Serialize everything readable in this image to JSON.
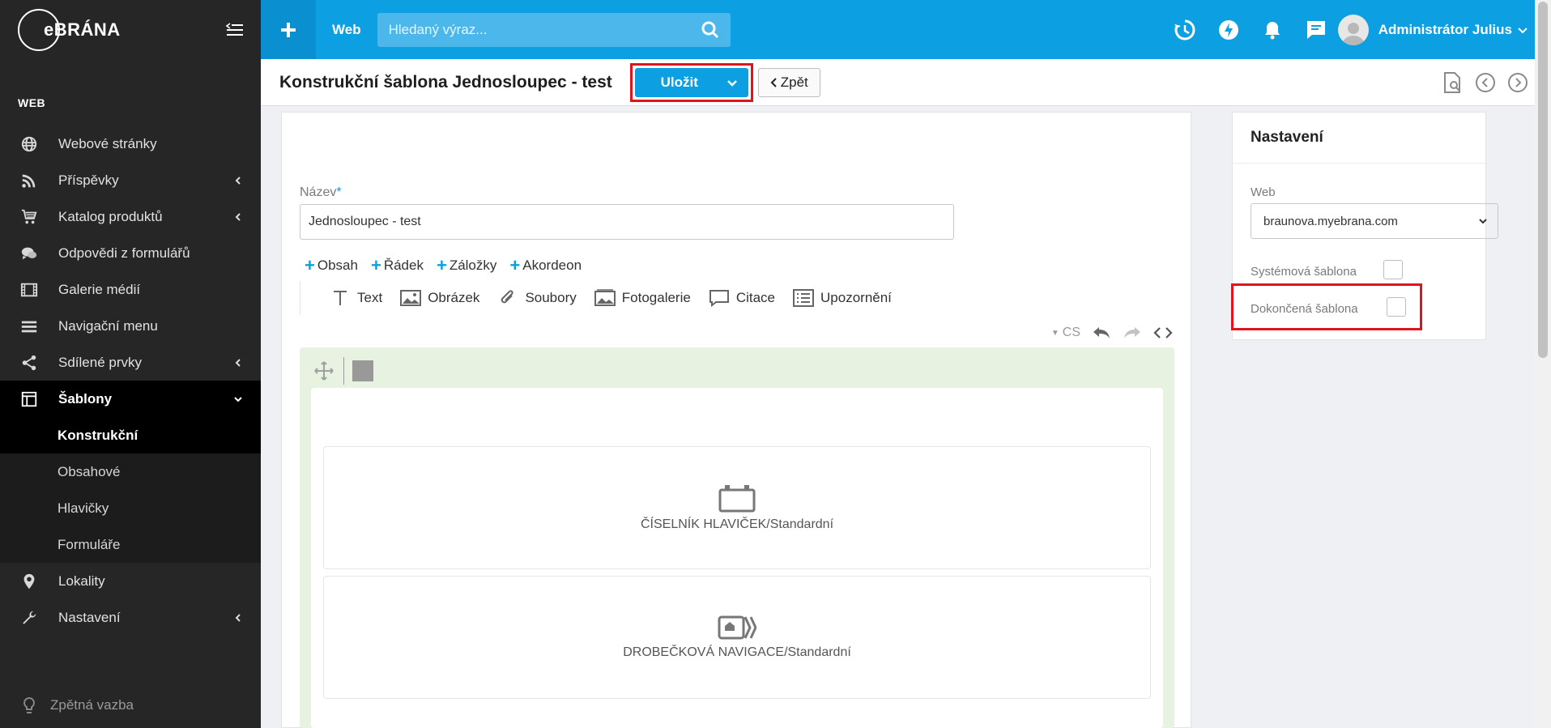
{
  "sidebar": {
    "logo": "eBRÁNA",
    "section_label": "WEB",
    "items": [
      {
        "label": "Webové stránky",
        "icon": "globe-icon"
      },
      {
        "label": "Příspěvky",
        "icon": "rss-icon"
      },
      {
        "label": "Katalog produktů",
        "icon": "cart-icon"
      },
      {
        "label": "Odpovědi z formulářů",
        "icon": "chat-icon"
      },
      {
        "label": "Galerie médií",
        "icon": "film-icon"
      },
      {
        "label": "Navigační menu",
        "icon": "menu-lines-icon"
      },
      {
        "label": "Sdílené prvky",
        "icon": "share-icon"
      },
      {
        "label": "Šablony",
        "icon": "template-icon"
      },
      {
        "label": "Lokality",
        "icon": "location-pin-icon"
      },
      {
        "label": "Nastavení",
        "icon": "wrench-icon"
      }
    ],
    "subitems": [
      {
        "label": "Konstrukční"
      },
      {
        "label": "Obsahové"
      },
      {
        "label": "Hlavičky"
      },
      {
        "label": "Formuláře"
      }
    ],
    "feedback": "Zpětná vazba"
  },
  "topbar": {
    "web_label": "Web",
    "search_placeholder": "Hledaný výraz...",
    "user_name": "Administrátor Julius"
  },
  "header": {
    "title": "Konstrukční šablona Jednosloupec - test",
    "save_label": "Uložit",
    "back_label": "Zpět"
  },
  "editor": {
    "name_label": "Název",
    "name_required": "*",
    "name_value": "Jednosloupec - test",
    "add_buttons": [
      "Obsah",
      "Řádek",
      "Záložky",
      "Akordeon"
    ],
    "elements": [
      "Text",
      "Obrázek",
      "Soubory",
      "Fotogalerie",
      "Citace",
      "Upozornění"
    ],
    "lang": "CS",
    "blocks": [
      {
        "label": "ČÍSELNÍK HLAVIČEK/Standardní"
      },
      {
        "label": "DROBEČKOVÁ NAVIGACE/Standardní"
      }
    ]
  },
  "settings": {
    "title": "Nastavení",
    "web_label": "Web",
    "web_value": "braunova.myebrana.com",
    "system_template_label": "Systémová šablona",
    "finished_template_label": "Dokončená šablona"
  },
  "colors": {
    "primary": "#0c9fe2",
    "sidebar_bg": "#262626",
    "highlight": "#e0141e",
    "green_bg": "#e8f2e1"
  }
}
